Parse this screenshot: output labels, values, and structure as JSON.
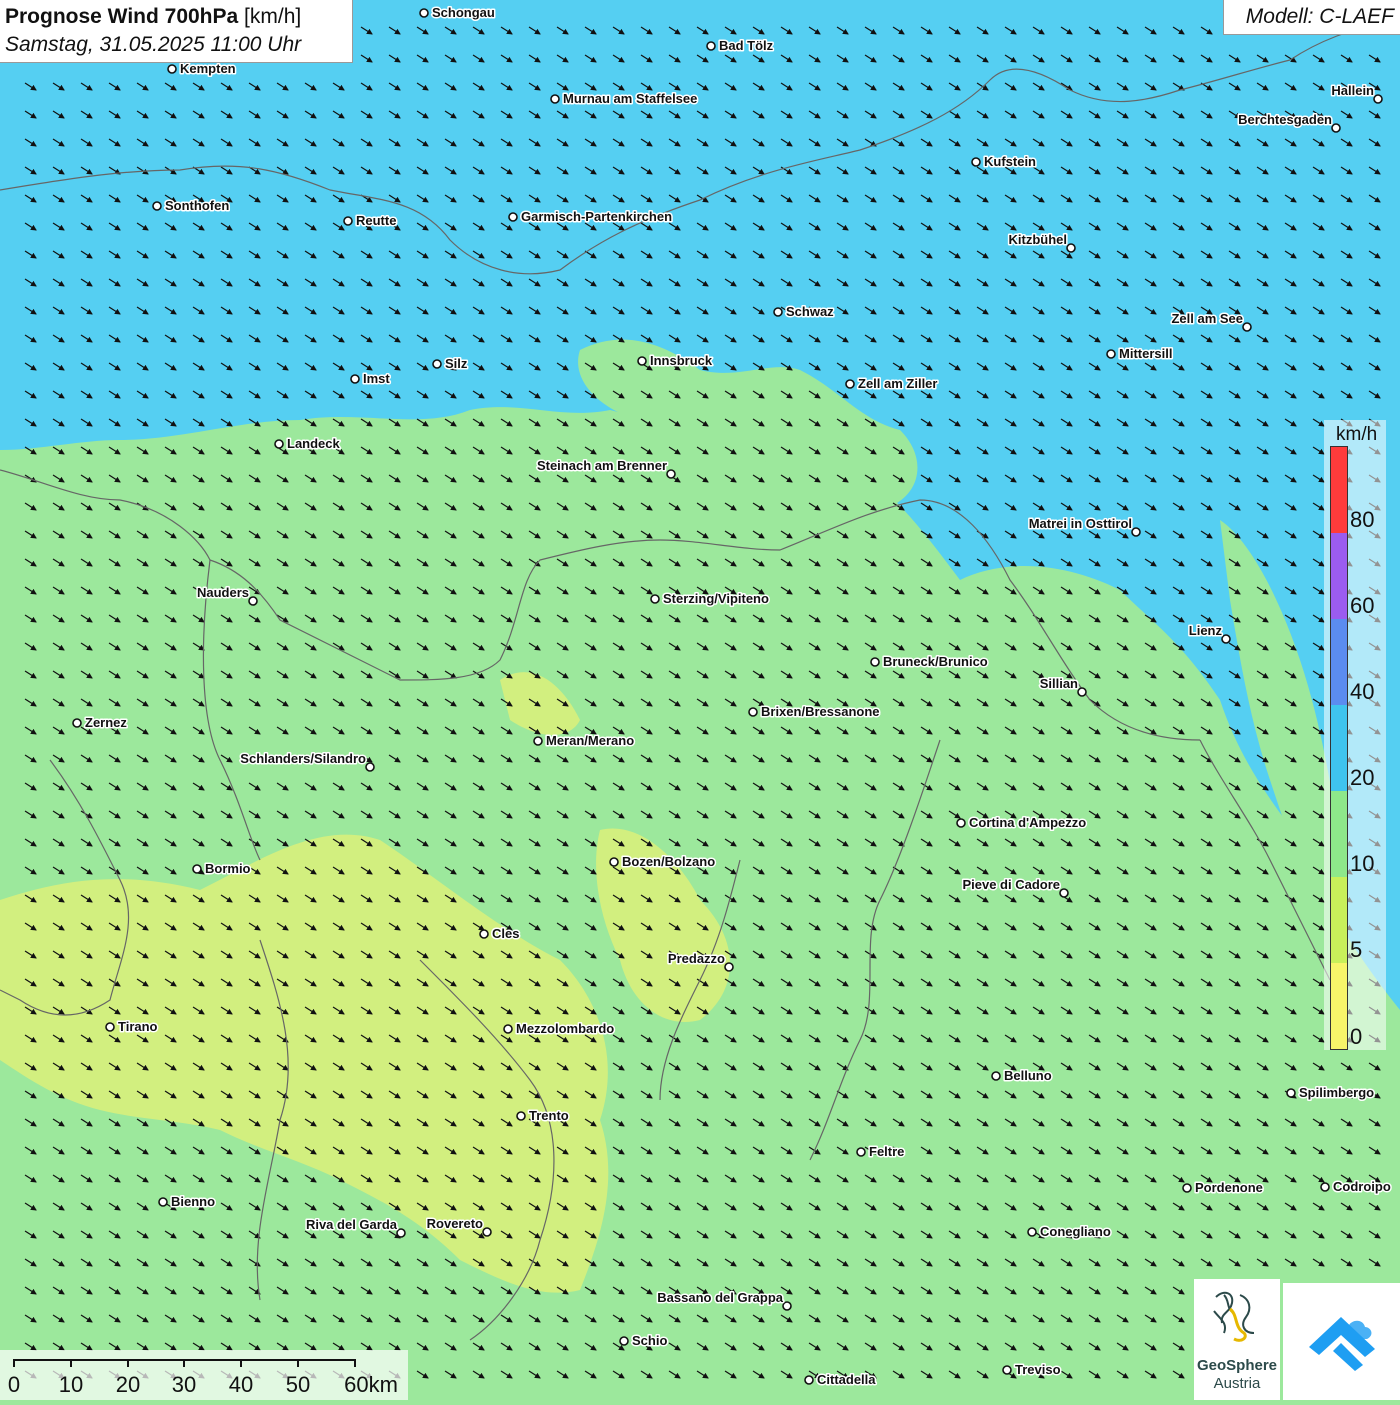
{
  "title": {
    "bold": "Prognose Wind 700hPa",
    "unit": " [km/h]",
    "datetime": "Samstag, 31.05.2025 11:00 Uhr"
  },
  "model": "Modell: C-LAEF",
  "legend": {
    "unit": "km/h",
    "labels": [
      "80",
      "60",
      "40",
      "20",
      "10",
      "5",
      "0"
    ],
    "colors": [
      "#ff3b3b",
      "#9b5cf0",
      "#5b8cf0",
      "#3fc4ee",
      "#8ee88a",
      "#c8f05a",
      "#f7f56a"
    ]
  },
  "scale_bar": {
    "labels": [
      "0",
      "10",
      "20",
      "30",
      "40",
      "50",
      "60km"
    ]
  },
  "logos": {
    "geosphere_line1": "GeoSphere",
    "geosphere_line2": "Austria"
  },
  "wind": {
    "direction": "from north-west towards south-east",
    "shading": "blue (20-40 km/h) in the north, green (10-20 km/h) centre, yellow-green (5-10 km/h) in the south-west"
  },
  "cities": [
    {
      "name": "Schongau"
    },
    {
      "name": "Bad Tölz"
    },
    {
      "name": "Kempten"
    },
    {
      "name": "Murnau am Staffelsee"
    },
    {
      "name": "Hallein"
    },
    {
      "name": "Berchtesgaden"
    },
    {
      "name": "Kufstein"
    },
    {
      "name": "Sonthofen"
    },
    {
      "name": "Reutte"
    },
    {
      "name": "Garmisch-Partenkirchen"
    },
    {
      "name": "Kitzbühel"
    },
    {
      "name": "Schwaz"
    },
    {
      "name": "Zell am See"
    },
    {
      "name": "Innsbruck"
    },
    {
      "name": "Silz"
    },
    {
      "name": "Mittersill"
    },
    {
      "name": "Imst"
    },
    {
      "name": "Zell am Ziller"
    },
    {
      "name": "Landeck"
    },
    {
      "name": "Steinach am Brenner"
    },
    {
      "name": "Matrei in Osttirol"
    },
    {
      "name": "Nauders"
    },
    {
      "name": "Sterzing/Vipiteno"
    },
    {
      "name": "Lienz"
    },
    {
      "name": "Bruneck/Brunico"
    },
    {
      "name": "Sillian"
    },
    {
      "name": "Brixen/Bressanone"
    },
    {
      "name": "Zernez"
    },
    {
      "name": "Meran/Merano"
    },
    {
      "name": "Schlanders/Silandro"
    },
    {
      "name": "Cortina d'Ampezzo"
    },
    {
      "name": "Bozen/Bolzano"
    },
    {
      "name": "Bormio"
    },
    {
      "name": "Pieve di Cadore"
    },
    {
      "name": "Cles"
    },
    {
      "name": "Predazzo"
    },
    {
      "name": "Tirano"
    },
    {
      "name": "Mezzolombardo"
    },
    {
      "name": "Belluno"
    },
    {
      "name": "Spilimbergo"
    },
    {
      "name": "Trento"
    },
    {
      "name": "Feltre"
    },
    {
      "name": "Pordenone"
    },
    {
      "name": "Codroipo"
    },
    {
      "name": "Bienno"
    },
    {
      "name": "Riva del Garda"
    },
    {
      "name": "Rovereto"
    },
    {
      "name": "Conegliano"
    },
    {
      "name": "Bassano del Grappa"
    },
    {
      "name": "Schio"
    },
    {
      "name": "Treviso"
    },
    {
      "name": "Cittadella"
    }
  ]
}
